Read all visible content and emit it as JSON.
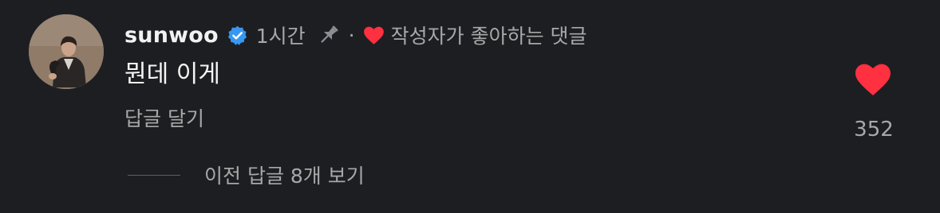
{
  "comment": {
    "username": "sunwoo",
    "time_ago": "1시간",
    "separator": "·",
    "creator_liked_text": "작성자가 좋아하는 댓글",
    "text": "뭔데 이게",
    "reply_label": "답글 달기",
    "like_count": "352",
    "view_replies_label": "이전 답글 8개 보기"
  },
  "icons": {
    "verified": "verified-badge-icon",
    "pin": "pin-icon",
    "creator_heart": "heart-icon",
    "like": "heart-icon"
  },
  "colors": {
    "background": "#1c1e22",
    "verified_blue": "#3897f0",
    "heart_red": "#ff3040",
    "muted_text": "#a8a8a8",
    "primary_text": "#f5f5f5"
  }
}
